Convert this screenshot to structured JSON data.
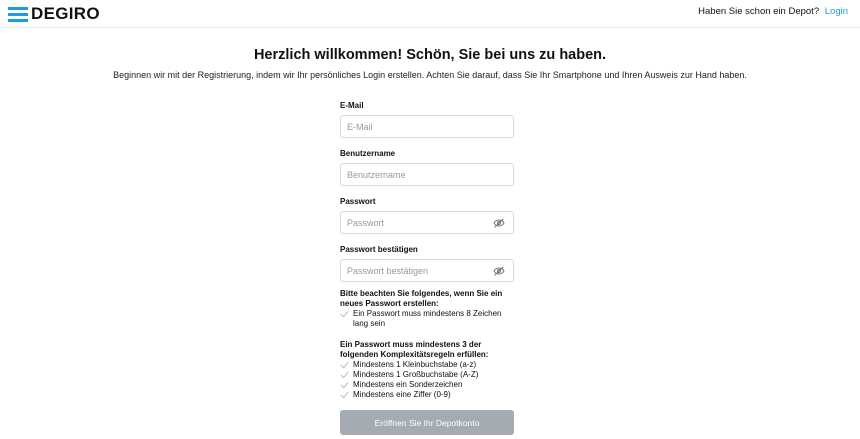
{
  "header": {
    "brand": "DEGIRO",
    "login_prompt": "Haben Sie schon ein Depot?",
    "login_link": "Login"
  },
  "intro": {
    "title": "Herzlich willkommen! Schön, Sie bei uns zu haben.",
    "subtitle": "Beginnen wir mit der Registrierung, indem wir Ihr persönliches Login erstellen. Achten Sie darauf, dass Sie Ihr Smartphone und Ihren Ausweis zur Hand haben."
  },
  "form": {
    "email": {
      "label": "E-Mail",
      "placeholder": "E-Mail",
      "value": ""
    },
    "username": {
      "label": "Benutzername",
      "placeholder": "Benutzername",
      "value": ""
    },
    "password": {
      "label": "Passwort",
      "placeholder": "Passwort",
      "value": ""
    },
    "password_confirm": {
      "label": "Passwort bestätigen",
      "placeholder": "Passwort bestätigen",
      "value": ""
    }
  },
  "rules": {
    "intro": "Bitte beachten Sie folgendes, wenn Sie ein neues Passwort erstellen:",
    "length_rule": "Ein Passwort muss mindestens 8 Zeichen lang sein",
    "complexity_intro": "Ein Passwort muss mindestens 3 der folgenden Komplexitätsregeln erfüllen:",
    "complexity_rules": [
      "Mindestens 1 Kleinbuchstabe (a-z)",
      "Mindestens 1 Großbuchstabe (A-Z)",
      "Mindestens ein Sonderzeichen",
      "Mindestens eine Ziffer (0-9)"
    ]
  },
  "submit": {
    "label": "Eröffnen Sie Ihr Depotkonto"
  },
  "colors": {
    "brand_blue": "#1e9be1",
    "button_disabled": "#a4abb2",
    "check_gray": "#bdbdbd"
  }
}
